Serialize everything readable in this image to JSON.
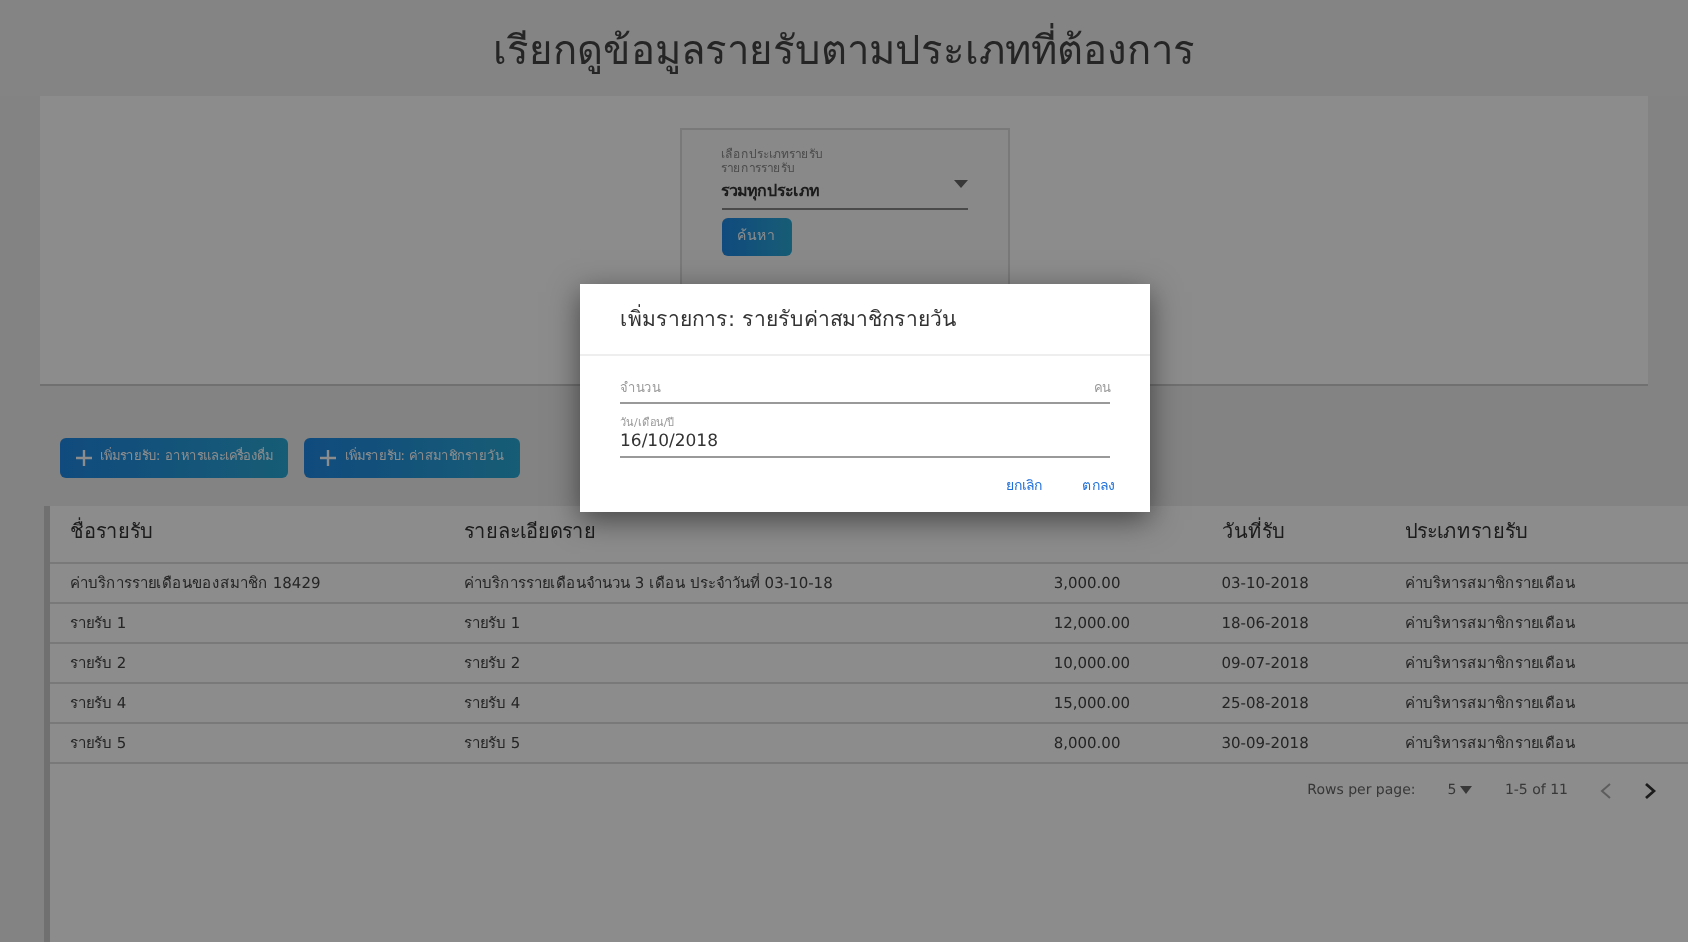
{
  "page_title": "เรียกดูข้อมูลรายรับตามประเภทที่ต้องการ",
  "filter": {
    "caption": "เลือกประเภทรายรับ",
    "field_label": "รายการรายรับ",
    "value": "รวมทุกประเภท",
    "button": "ค้นหา"
  },
  "add_buttons": [
    "เพิ่มรายรับ: อาหารและเครื่องดื่ม",
    "เพิ่มรายรับ: ค่าสมาชิกรายวัน"
  ],
  "table": {
    "headings": {
      "name": "ชื่อรายรับ",
      "detail": "รายละเอียดราย",
      "date": "วันที่รับ",
      "type": "ประเภทรายรับ"
    },
    "rows": [
      {
        "name": "ค่าบริการรายเดือนของสมาชิก 18429",
        "detail": "ค่าบริการรายเดือนจำนวน 3 เดือน ประจำวันที่ 03-10-18",
        "amount": "3,000.00",
        "date": "03-10-2018",
        "type": "ค่าบริหารสมาชิกรายเดือน"
      },
      {
        "name": "รายรับ 1",
        "detail": "รายรับ 1",
        "amount": "12,000.00",
        "date": "18-06-2018",
        "type": "ค่าบริหารสมาชิกรายเดือน"
      },
      {
        "name": "รายรับ 2",
        "detail": "รายรับ 2",
        "amount": "10,000.00",
        "date": "09-07-2018",
        "type": "ค่าบริหารสมาชิกรายเดือน"
      },
      {
        "name": "รายรับ 4",
        "detail": "รายรับ 4",
        "amount": "15,000.00",
        "date": "25-08-2018",
        "type": "ค่าบริหารสมาชิกรายเดือน"
      },
      {
        "name": "รายรับ 5",
        "detail": "รายรับ 5",
        "amount": "8,000.00",
        "date": "30-09-2018",
        "type": "ค่าบริหารสมาชิกรายเดือน"
      }
    ],
    "pagination": {
      "rows_label": "Rows per page:",
      "rows_value": "5",
      "range": "1-5 of 11"
    }
  },
  "dialog": {
    "title": "เพิ่มรายการ: รายรับค่าสมาชิกรายวัน",
    "amount_placeholder": "จำนวน",
    "amount_suffix": "คน",
    "date_label": "วัน/เดือน/ปี",
    "date_value": "16/10/2018",
    "buttons": [
      "ยกเลิก",
      "ตกลง"
    ]
  }
}
